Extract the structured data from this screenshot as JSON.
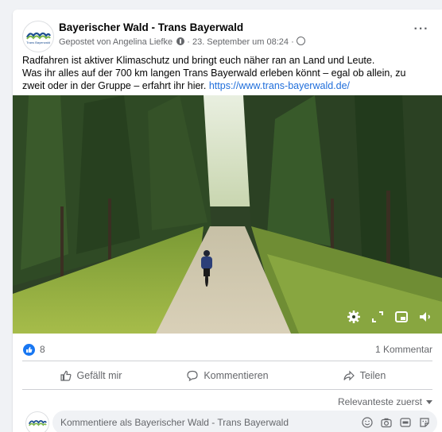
{
  "post": {
    "page_name": "Bayerischer Wald - Trans Bayerwald",
    "logo_text": "Trans Bayerwald",
    "posted_by": "Gepostet von Angelina Liefke",
    "date": "· 23. September um 08:24 ·",
    "more_label": "···",
    "text_line1": "Radfahren ist aktiver Klimaschutz und bringt euch näher ran an Land und Leute.",
    "text_line2": "Was ihr alles auf der 700 km langen Trans Bayerwald erleben könnt – egal ob allein, zu zweit oder in der Gruppe – erfahrt ihr hier.",
    "link": "https://www.trans-bayerwald.de/"
  },
  "video": {
    "controls": [
      "settings-icon",
      "expand-icon",
      "picture-in-picture-icon",
      "volume-icon"
    ]
  },
  "stats": {
    "reaction_count": "8",
    "comment_count": "1 Kommentar"
  },
  "actions": {
    "like": "Gefällt mir",
    "comment": "Kommentieren",
    "share": "Teilen"
  },
  "comments": {
    "sort_label": "Relevanteste zuerst",
    "composer_placeholder": "Kommentiere als Bayerischer Wald - Trans Bayerwald",
    "composer_icons": [
      "emoji-icon",
      "camera-icon",
      "gif-icon",
      "sticker-icon"
    ]
  },
  "colors": {
    "link": "#216fdb",
    "like_blue": "#1877f2",
    "secondary_text": "#65676b",
    "logo_green": "#7ab648",
    "logo_blue": "#1d4f91"
  }
}
